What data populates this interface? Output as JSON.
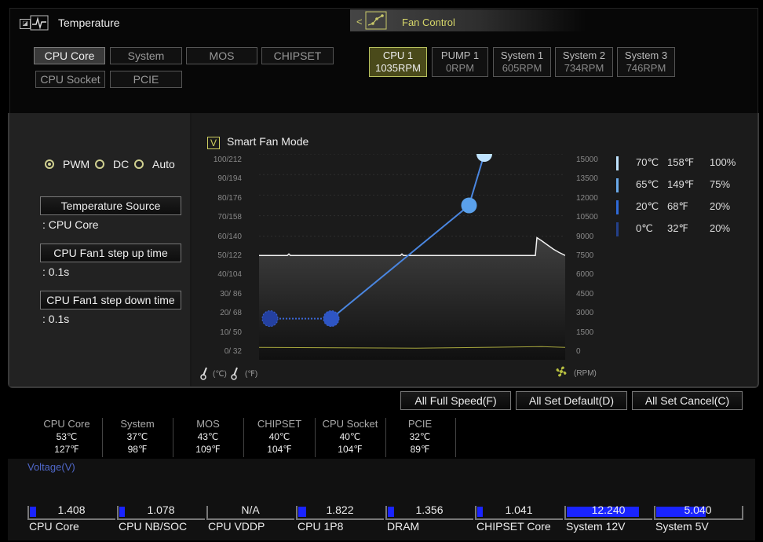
{
  "temperature_panel": {
    "title": "Temperature",
    "sources": [
      "CPU Core",
      "System",
      "MOS",
      "CHIPSET",
      "CPU Socket",
      "PCIE"
    ],
    "active_source": "CPU Core"
  },
  "fan_control": {
    "title": "Fan Control",
    "fans": [
      {
        "name": "CPU 1",
        "rpm": "1035RPM",
        "active": true
      },
      {
        "name": "PUMP 1",
        "rpm": "0RPM",
        "active": false
      },
      {
        "name": "System 1",
        "rpm": "605RPM",
        "active": false
      },
      {
        "name": "System 2",
        "rpm": "734RPM",
        "active": false
      },
      {
        "name": "System 3",
        "rpm": "746RPM",
        "active": false
      }
    ]
  },
  "mode": {
    "options": [
      "PWM",
      "DC",
      "Auto"
    ],
    "selected": "PWM"
  },
  "settings": {
    "temp_source_label": "Temperature Source",
    "temp_source_value": ": CPU Core",
    "step_up_label": "CPU Fan1 step up time",
    "step_up_value": ": 0.1s",
    "step_down_label": "CPU Fan1 step down time",
    "step_down_value": ": 0.1s"
  },
  "smart_fan": {
    "label": "Smart Fan Mode",
    "checked": true,
    "check_glyph": "V"
  },
  "chart_data": {
    "type": "line",
    "y_left_ticks": [
      "100/212",
      "90/194",
      "80/176",
      "70/158",
      "60/140",
      "50/122",
      "40/104",
      "30/ 86",
      "20/ 68",
      "10/ 50",
      "0/ 32"
    ],
    "y_right_ticks": [
      "15000",
      "13500",
      "12000",
      "10500",
      "9000",
      "7500",
      "6000",
      "4500",
      "3000",
      "1500",
      "0"
    ],
    "left_unit_c": "(℃)",
    "left_unit_f": "(℉)",
    "right_unit": "(RPM)",
    "ylim_temp_c": [
      0,
      100
    ],
    "ylim_rpm": [
      0,
      15000
    ],
    "curve_points": [
      {
        "temp_c": 0,
        "percent": 20
      },
      {
        "temp_c": 20,
        "percent": 20
      },
      {
        "temp_c": 65,
        "percent": 75
      },
      {
        "temp_c": 70,
        "percent": 100
      }
    ],
    "rpm_history_level": 7600,
    "rpm_history_peak": 8900,
    "temp_history_level_c": 6
  },
  "legend": [
    {
      "c": "70℃",
      "f": "158℉",
      "p": "100%",
      "color": "#bfe3ff"
    },
    {
      "c": "65℃",
      "f": "149℉",
      "p": "75%",
      "color": "#6aa9ea"
    },
    {
      "c": "20℃",
      "f": "68℉",
      "p": "20%",
      "color": "#2f6ad8"
    },
    {
      "c": "0℃",
      "f": "32℉",
      "p": "20%",
      "color": "#24408a"
    }
  ],
  "actions": {
    "full_speed": "All Full Speed(F)",
    "set_default": "All Set Default(D)",
    "set_cancel": "All Set Cancel(C)"
  },
  "readings": [
    {
      "name": "CPU Core",
      "c": "53℃",
      "f": "127℉"
    },
    {
      "name": "System",
      "c": "37℃",
      "f": "98℉"
    },
    {
      "name": "MOS",
      "c": "43℃",
      "f": "109℉"
    },
    {
      "name": "CHIPSET",
      "c": "40℃",
      "f": "104℉"
    },
    {
      "name": "CPU Socket",
      "c": "40℃",
      "f": "104℉"
    },
    {
      "name": "PCIE",
      "c": "32℃",
      "f": "89℉"
    }
  ],
  "voltage": {
    "title": "Voltage(V)",
    "items": [
      {
        "name": "CPU Core",
        "value": "1.408",
        "fill": 0.08
      },
      {
        "name": "CPU NB/SOC",
        "value": "1.078",
        "fill": 0.06
      },
      {
        "name": "CPU VDDP",
        "value": "N/A",
        "fill": 0
      },
      {
        "name": "CPU 1P8",
        "value": "1.822",
        "fill": 0.1
      },
      {
        "name": "DRAM",
        "value": "1.356",
        "fill": 0.08
      },
      {
        "name": "CHIPSET Core",
        "value": "1.041",
        "fill": 0.06
      },
      {
        "name": "System 12V",
        "value": "12.240",
        "fill": 0.9
      },
      {
        "name": "System 5V",
        "value": "5.040",
        "fill": 0.62
      }
    ]
  }
}
